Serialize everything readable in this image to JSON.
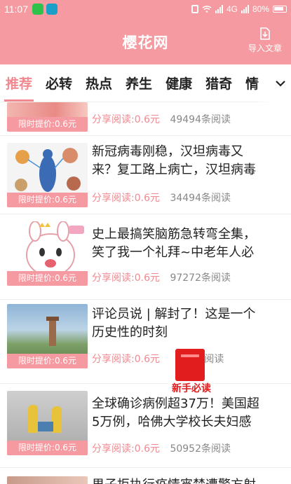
{
  "status_bar": {
    "time": "11:07",
    "battery": "80%",
    "network": "4G"
  },
  "header": {
    "title": "樱花网",
    "import_label": "导入文章"
  },
  "tabs": [
    {
      "label": "推荐",
      "active": true
    },
    {
      "label": "必转",
      "active": false
    },
    {
      "label": "热点",
      "active": false
    },
    {
      "label": "养生",
      "active": false
    },
    {
      "label": "健康",
      "active": false
    },
    {
      "label": "猎奇",
      "active": false
    },
    {
      "label": "情",
      "active": false
    }
  ],
  "articles": [
    {
      "title": "",
      "price_tag": "限时提价:0.6元",
      "share": "分享阅读:0.6元",
      "reads": "49494条阅读"
    },
    {
      "title_line1": "新冠病毒刚稳，汉坦病毒又",
      "title_line2": "来？复工路上病亡，汉坦病毒",
      "price_tag": "限时提价:0.6元",
      "share": "分享阅读:0.6元",
      "reads": "34494条阅读"
    },
    {
      "title_line1": "史上最搞笑脑筋急转弯全集，",
      "title_line2": "笑了我一个礼拜~中老年人必",
      "price_tag": "限时提价:0.6元",
      "share": "分享阅读:0.6元",
      "reads": "97272条阅读"
    },
    {
      "title_line1": "评论员说 | 解封了！这是一个",
      "title_line2": "历史性的时刻",
      "price_tag": "限时提价:0.6元",
      "share": "分享阅读:0.6元",
      "reads": "8条阅读"
    },
    {
      "title_line1": "全球确诊病例超37万！美国超",
      "title_line2": "5万例，哈佛大学校长夫妇感",
      "price_tag": "限时提价:0.6元",
      "share": "分享阅读:0.6元",
      "reads": "50952条阅读"
    },
    {
      "title_line1": "男子拒执行疫情宵禁遭警方射",
      "title_line2": ""
    }
  ],
  "floating_badge": {
    "label": "新手必读"
  },
  "colors": {
    "brand": "#f59aa0",
    "accent": "#f08990"
  }
}
